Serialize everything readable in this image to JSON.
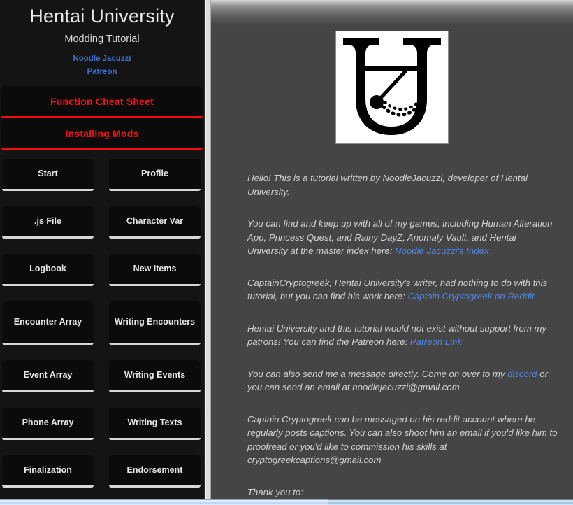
{
  "sidebar": {
    "title": "Hentai University",
    "subtitle": "Modding Tutorial",
    "links": [
      {
        "label": "Noodle Jacuzzi",
        "name": "link-noodle-jacuzzi"
      },
      {
        "label": "Patreon",
        "name": "link-patreon"
      }
    ],
    "red_buttons": [
      {
        "label": "Function Cheat Sheet",
        "name": "button-function-cheat-sheet"
      },
      {
        "label": "Installing Mods",
        "name": "button-installing-mods"
      }
    ],
    "nav_buttons": [
      {
        "label": "Start",
        "name": "button-start",
        "tall": false
      },
      {
        "label": "Profile",
        "name": "button-profile",
        "tall": false
      },
      {
        "label": ".js File",
        "name": "button-js-file",
        "tall": false
      },
      {
        "label": "Character Var",
        "name": "button-character-var",
        "tall": false
      },
      {
        "label": "Logbook",
        "name": "button-logbook",
        "tall": false
      },
      {
        "label": "New Items",
        "name": "button-new-items",
        "tall": false
      },
      {
        "label": "Encounter Array",
        "name": "button-encounter-array",
        "tall": true
      },
      {
        "label": "Writing Encounters",
        "name": "button-writing-encounters",
        "tall": true
      },
      {
        "label": "Event Array",
        "name": "button-event-array",
        "tall": false
      },
      {
        "label": "Writing Events",
        "name": "button-writing-events",
        "tall": false
      },
      {
        "label": "Phone Array",
        "name": "button-phone-array",
        "tall": false
      },
      {
        "label": "Writing Texts",
        "name": "button-writing-texts",
        "tall": false
      },
      {
        "label": "Finalization",
        "name": "button-finalization",
        "tall": false
      },
      {
        "label": "Endorsement",
        "name": "button-endorsement",
        "tall": false
      }
    ]
  },
  "content": {
    "logo_alt": "hentai-university-u-pendulum-logo",
    "paragraphs": [
      {
        "id": "intro",
        "runs": [
          {
            "type": "text",
            "text": "Hello! This is a tutorial written by NoodleJacuzzi, developer of Hentai University."
          }
        ]
      },
      {
        "id": "games-index",
        "runs": [
          {
            "type": "text",
            "text": "You can find and keep up with all of my games, including Human Alteration App, Princess Quest, and Rainy DayZ, Anomaly Vault, and Hentai University at the master index here: "
          },
          {
            "type": "link",
            "text": "Noodle Jacuzzi's Index",
            "name": "link-noodle-jacuzzis-index"
          }
        ]
      },
      {
        "id": "writer-credit",
        "runs": [
          {
            "type": "text",
            "text": "CaptainCryptogreek, Hentai University's writer, had nothing to do with this tutorial, but you can find his work here: "
          },
          {
            "type": "link",
            "text": "Captain Cryptogreek on Reddit",
            "name": "link-captain-cryptogreek-on-reddit"
          }
        ]
      },
      {
        "id": "patreon-support",
        "runs": [
          {
            "type": "text",
            "text": "Hentai University and this tutorial would not exist without support from my patrons! You can find the Patreon here: "
          },
          {
            "type": "link",
            "text": "Patreon Link",
            "name": "link-patreon-link"
          }
        ]
      },
      {
        "id": "contact",
        "runs": [
          {
            "type": "text",
            "text": "You can also send me a message directly. Come on over to my "
          },
          {
            "type": "link",
            "text": "discord",
            "name": "link-discord"
          },
          {
            "type": "text",
            "text": " or you can send an email at noodlejacuzzi@gmail.com"
          }
        ]
      },
      {
        "id": "cryptogreek-contact",
        "runs": [
          {
            "type": "text",
            "text": "Captain Cryptogreek can be messaged on his reddit account where he regularly posts captions. You can also shoot him an email if you'd like him to proofread or you'd like to commission his skills at cryptogreekcaptions@gmail.com"
          }
        ]
      },
      {
        "id": "thanks",
        "runs": [
          {
            "type": "text",
            "text": "Thank you to:"
          }
        ]
      }
    ]
  },
  "colors": {
    "sidebar_bg": "#141414",
    "content_bg": "#454545",
    "accent_red": "#f20d0d",
    "link_blue": "#4d86e8",
    "sidebar_link_blue": "#3f72d4",
    "button_face": "#0b0b0b",
    "button_underline": "#d8d8d8",
    "text_light": "#d3d3d3"
  }
}
